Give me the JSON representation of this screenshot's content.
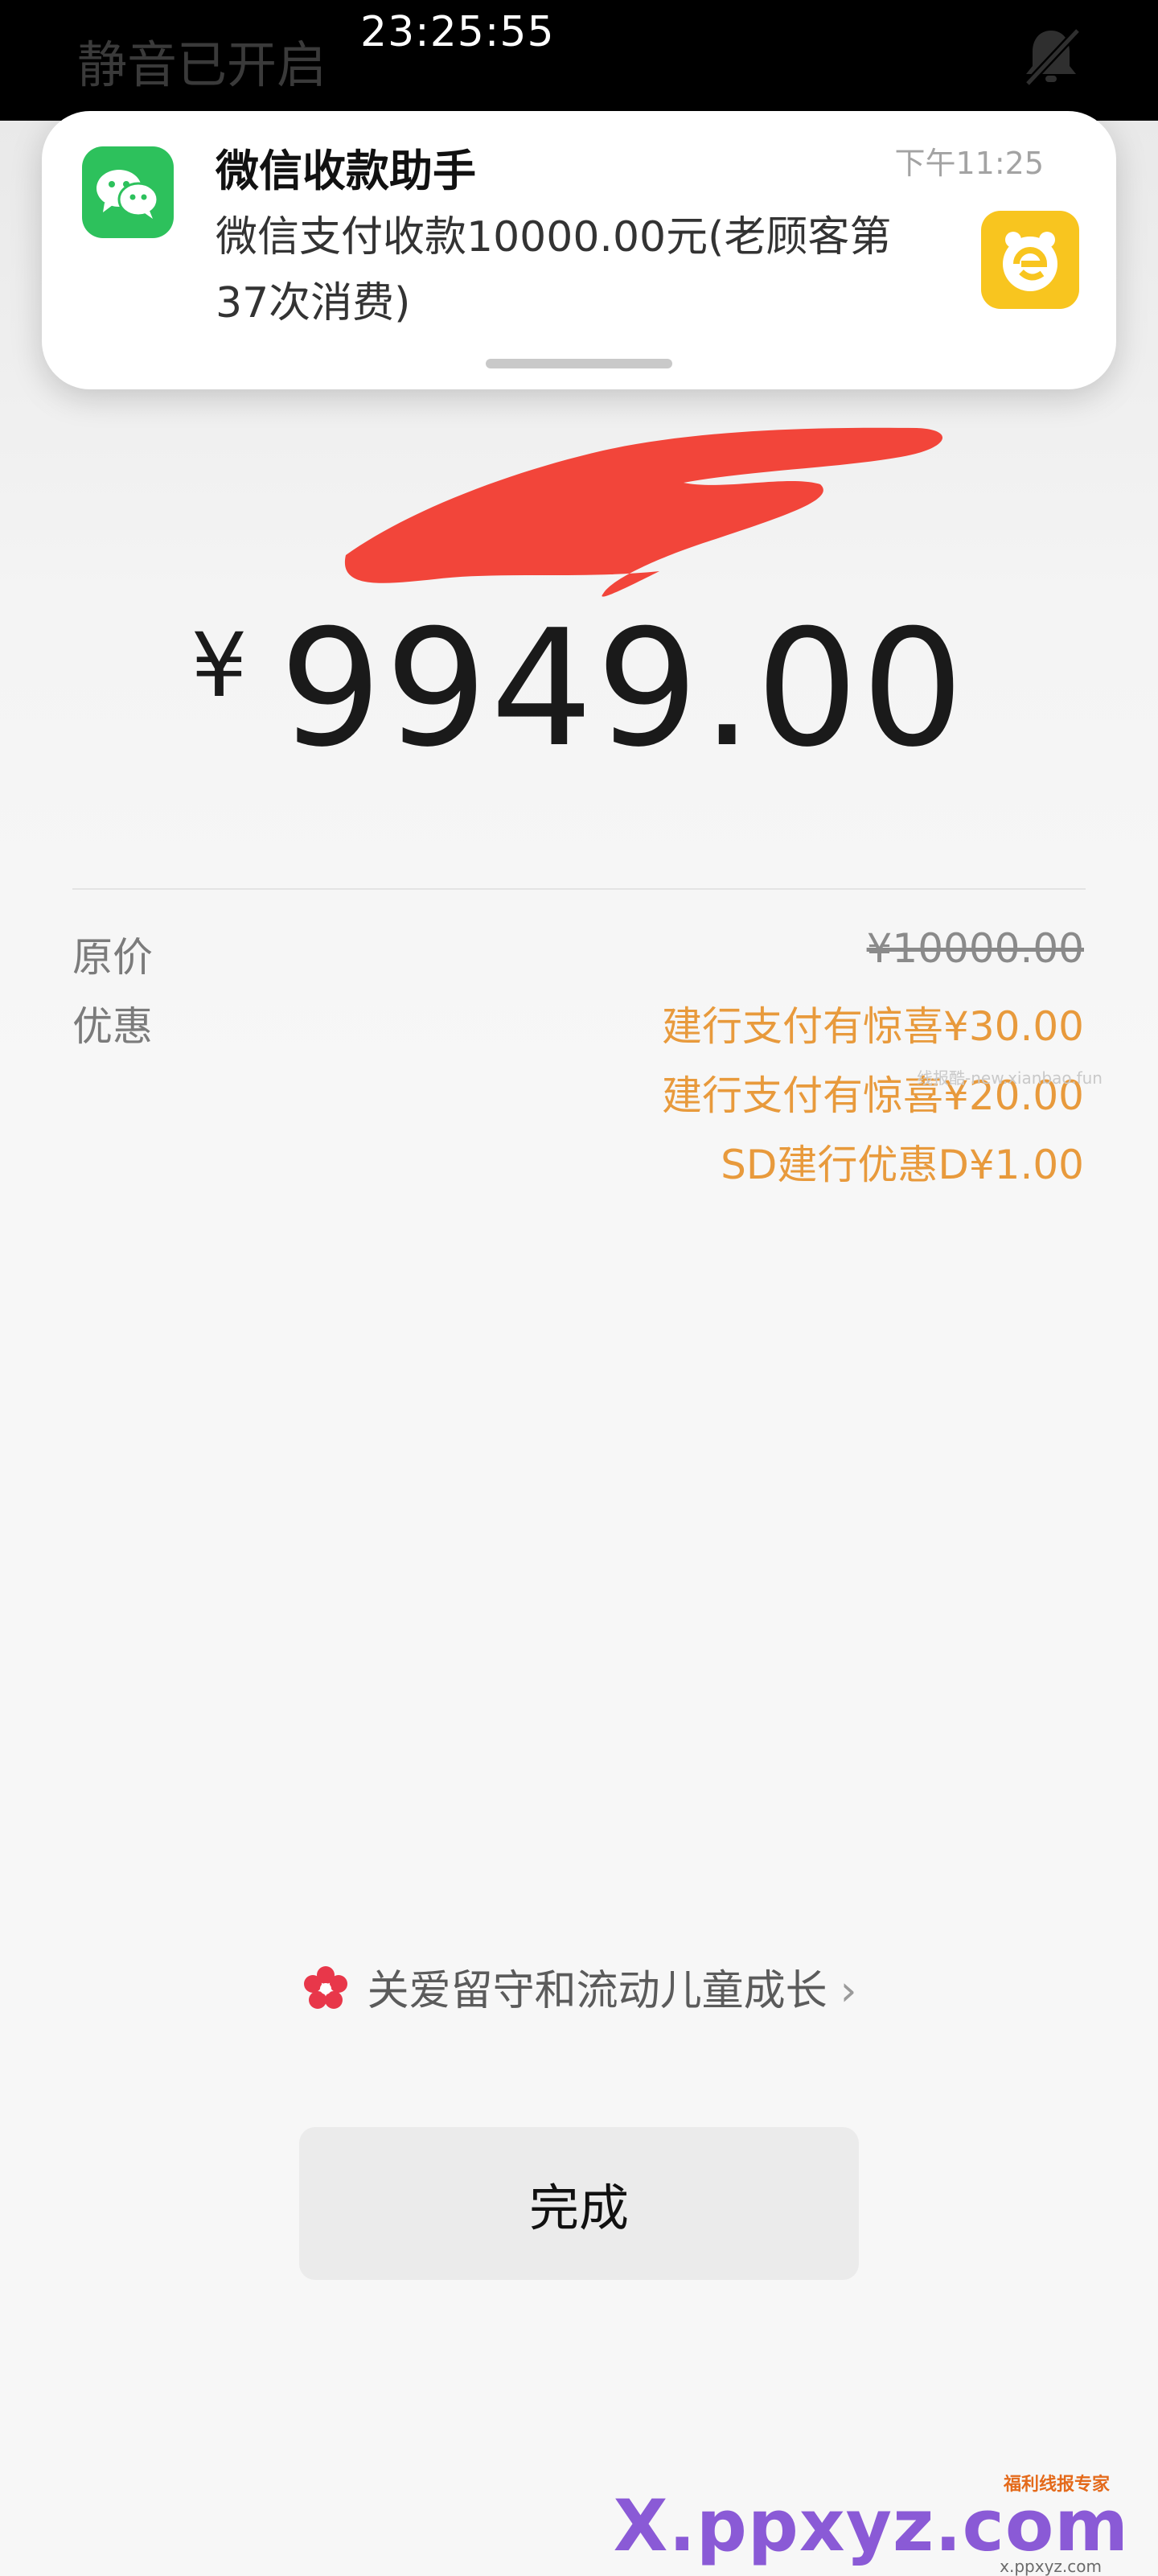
{
  "status_bar": {
    "left_text": "静音已开启",
    "time": "23:25:55",
    "icon": "bell-muted-icon"
  },
  "notification": {
    "app_icon": "wechat-icon",
    "title": "微信收款助手",
    "time": "下午11:25",
    "body": "微信支付收款10000.00元(老顾客第37次消费)",
    "side_app_icon": "yellow-app-icon"
  },
  "payment": {
    "currency_symbol": "¥",
    "amount": "9949.00"
  },
  "details": {
    "original_label": "原价",
    "original_value": "¥10000.00",
    "discount_label": "优惠",
    "discounts": [
      "建行支付有惊喜¥30.00",
      "建行支付有惊喜¥20.00",
      "SD建行优惠D¥1.00"
    ],
    "watermark": "线报酷-new.xianbao.fun"
  },
  "care_link": {
    "icon": "red-flower-icon",
    "text": "关爱留守和流动儿童成长",
    "chevron": "›"
  },
  "done_button": {
    "label": "完成"
  },
  "site_watermark": {
    "logo_text": "X.ppxyz.com",
    "tag": "福利线报专家",
    "sub": "x.ppxyz.com"
  },
  "colors": {
    "discount": "#e89a3c",
    "wechat_green": "#2dc15c",
    "redaction": "#f2453a"
  }
}
